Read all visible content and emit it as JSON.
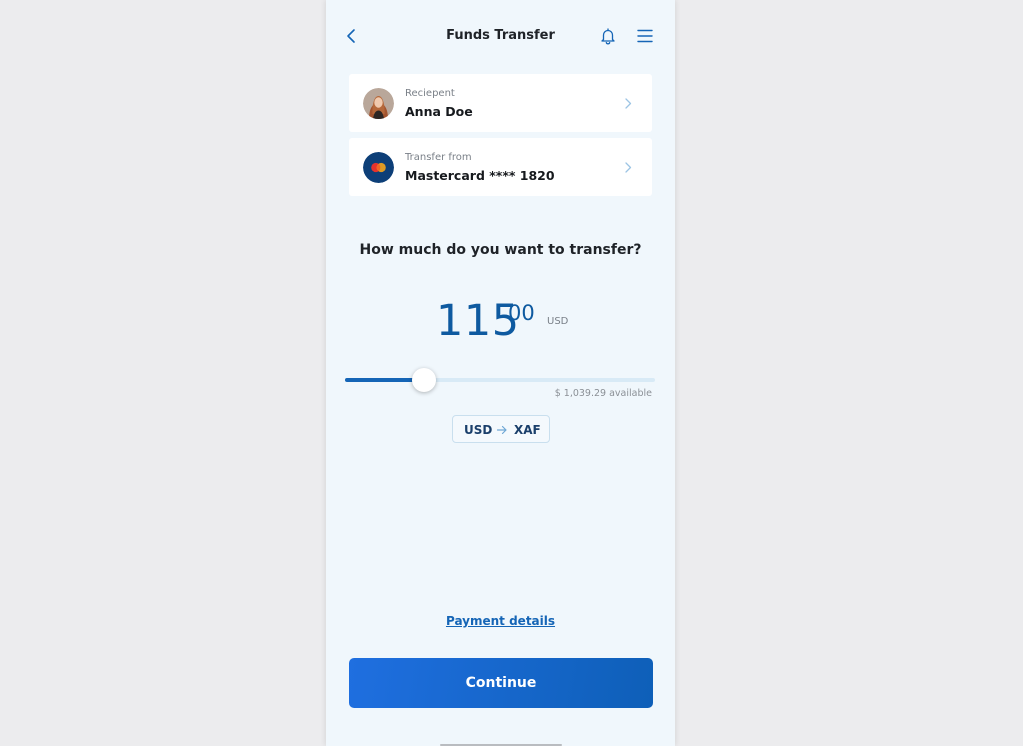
{
  "header": {
    "title": "Funds Transfer",
    "back_icon": "chevron-left-icon",
    "notifications_icon": "bell-icon",
    "menu_icon": "hamburger-menu-icon"
  },
  "recipient": {
    "label": "Reciepent",
    "name": "Anna Doe"
  },
  "source": {
    "label": "Transfer from",
    "account": "Mastercard **** 1820"
  },
  "question": "How much do you want to transfer?",
  "amount": {
    "integer": "115",
    "decimal": "00",
    "currency": "USD"
  },
  "slider": {
    "value": 115,
    "max": 1039.29,
    "fraction": 0.255
  },
  "available_text": "$ 1,039.29 available",
  "currency_pair": {
    "from": "USD",
    "to": "XAF"
  },
  "payment_details_link": "Payment details",
  "continue_label": "Continue",
  "colors": {
    "accent": "#1565b6",
    "background": "#f0f7fc",
    "page": "#ececee"
  }
}
